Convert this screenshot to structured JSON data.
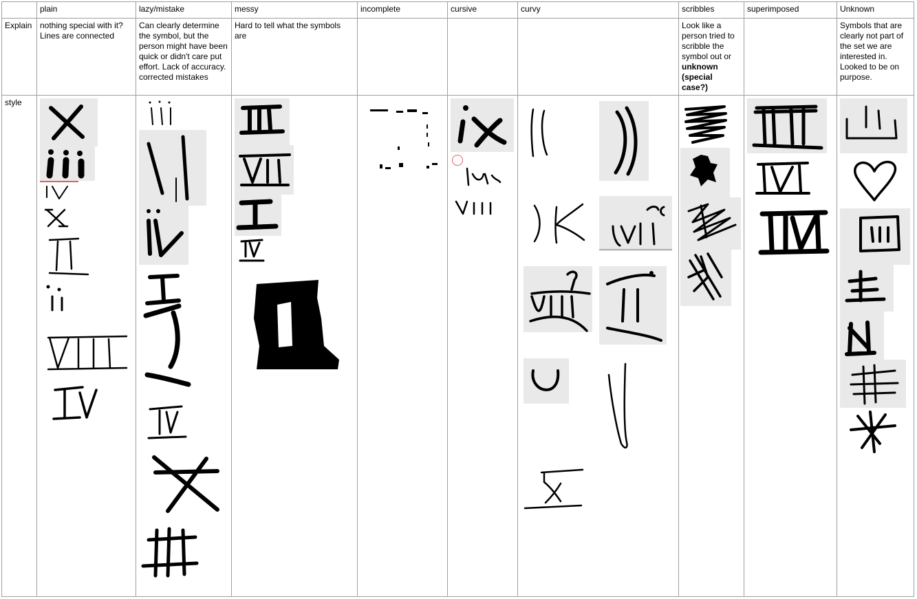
{
  "headers": [
    "",
    "plain",
    "lazy/mistake",
    "messy",
    "incomplete",
    "cursive",
    "curvy",
    "scribbles",
    "superimposed",
    "Unknown"
  ],
  "explain_row": {
    "label": "Explain",
    "plain": "nothing special with it? Lines are connected",
    "lazy": "Can clearly determine the symbol, but the person might have been quick or didn't care put effort. Lack of accuracy. corrected mistakes",
    "messy": "Hard to tell what the symbols are",
    "incomplete": "",
    "cursive": "",
    "curvy": "",
    "scribbles_prefix": "Look like a person tried to scribble the symbol out or ",
    "scribbles_bold": "unknown (special case?)",
    "superimposed": "",
    "unknown": "Symbols that are clearly not part of the set we are interested in. Looked to be on purpose."
  },
  "style_row": {
    "label": "style"
  },
  "glyph_samples": {
    "plain": [
      "X",
      "iii",
      "IV",
      "X",
      "II",
      "ii",
      "VIII",
      "IV"
    ],
    "lazy": [
      "iii",
      "II",
      "iv",
      "I",
      "I",
      "I",
      "IV",
      "X",
      "III"
    ],
    "messy": [
      "III",
      "VII",
      "I",
      "IV",
      "blob"
    ],
    "cursive": [
      "ix",
      "iv",
      "viii"
    ],
    "curvy": [
      "II",
      "II",
      "IX",
      "VII",
      "VIII",
      "II",
      "U",
      "V",
      "X"
    ],
    "scribbles": [
      "scribble",
      "scribble",
      "scribble",
      "scribble"
    ],
    "superimposed": [
      "II",
      "IV",
      "IV"
    ],
    "unknown": [
      "crown",
      "heart",
      "box",
      "E",
      "M",
      "E",
      "star"
    ]
  },
  "colors": {
    "border": "#9e9e9e",
    "sample_bg": "#e9e9e9",
    "red_mark": "#e06060"
  }
}
